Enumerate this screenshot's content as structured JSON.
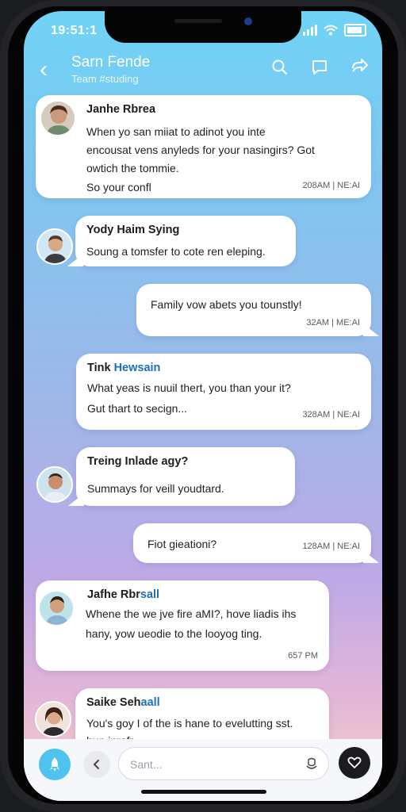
{
  "status": {
    "time": "19:51:1"
  },
  "header": {
    "title": "Sarn Fende",
    "subtitle": "Team #studing"
  },
  "messages": [
    {
      "sender": "Janhe Rbrea",
      "lines": [
        "When yo san miiat to adinot you inte",
        "encousat vens anyleds for your nasingirs? Got",
        "owtich the tommie.",
        "So your confl"
      ],
      "time": "208AM | NE:AI"
    },
    {
      "sender": "Yody Haim Sying",
      "lines": [
        "Soung a tomsfer to cote ren eleping."
      ],
      "time": ""
    },
    {
      "sender": "",
      "lines": [
        "Family vow abets you tounstly!"
      ],
      "time": "32AM | ME:AI"
    },
    {
      "sender_a": "Tink ",
      "sender_b": "Hewsain",
      "lines": [
        "What yeas is nuuil thert, you than your it?",
        "Gut thart to secign..."
      ],
      "time": "328AM | NE:AI"
    },
    {
      "sender": "Treing Inlade agy?",
      "lines": [
        "Summays for veill youdtard."
      ],
      "time": ""
    },
    {
      "sender": "",
      "lines": [
        "Fiot gieationi?"
      ],
      "time": "128AM | NE:AI"
    },
    {
      "sender_a": "Jafhe Rbr",
      "sender_b": "sall",
      "lines": [
        "Whene the we jve fire aMI?, hove liadis ihs",
        "hany, yow ueodie to the looyog ting."
      ],
      "time": "657 PM"
    },
    {
      "sender_a": "Saike Seh",
      "sender_b": "aall",
      "lines": [
        "You's goy I of the is hane to evelutting sst.",
        "hun inrafr"
      ],
      "time": ""
    }
  ],
  "composer": {
    "placeholder": "Sant..."
  },
  "colors": {
    "accent": "#4fc3f0",
    "heart_button": "#1b1c1f"
  },
  "icons": [
    "back-icon",
    "search-icon",
    "chat-icon",
    "share-icon",
    "rocket-icon",
    "chevron-left-icon",
    "mic-icon",
    "heart-icon"
  ]
}
